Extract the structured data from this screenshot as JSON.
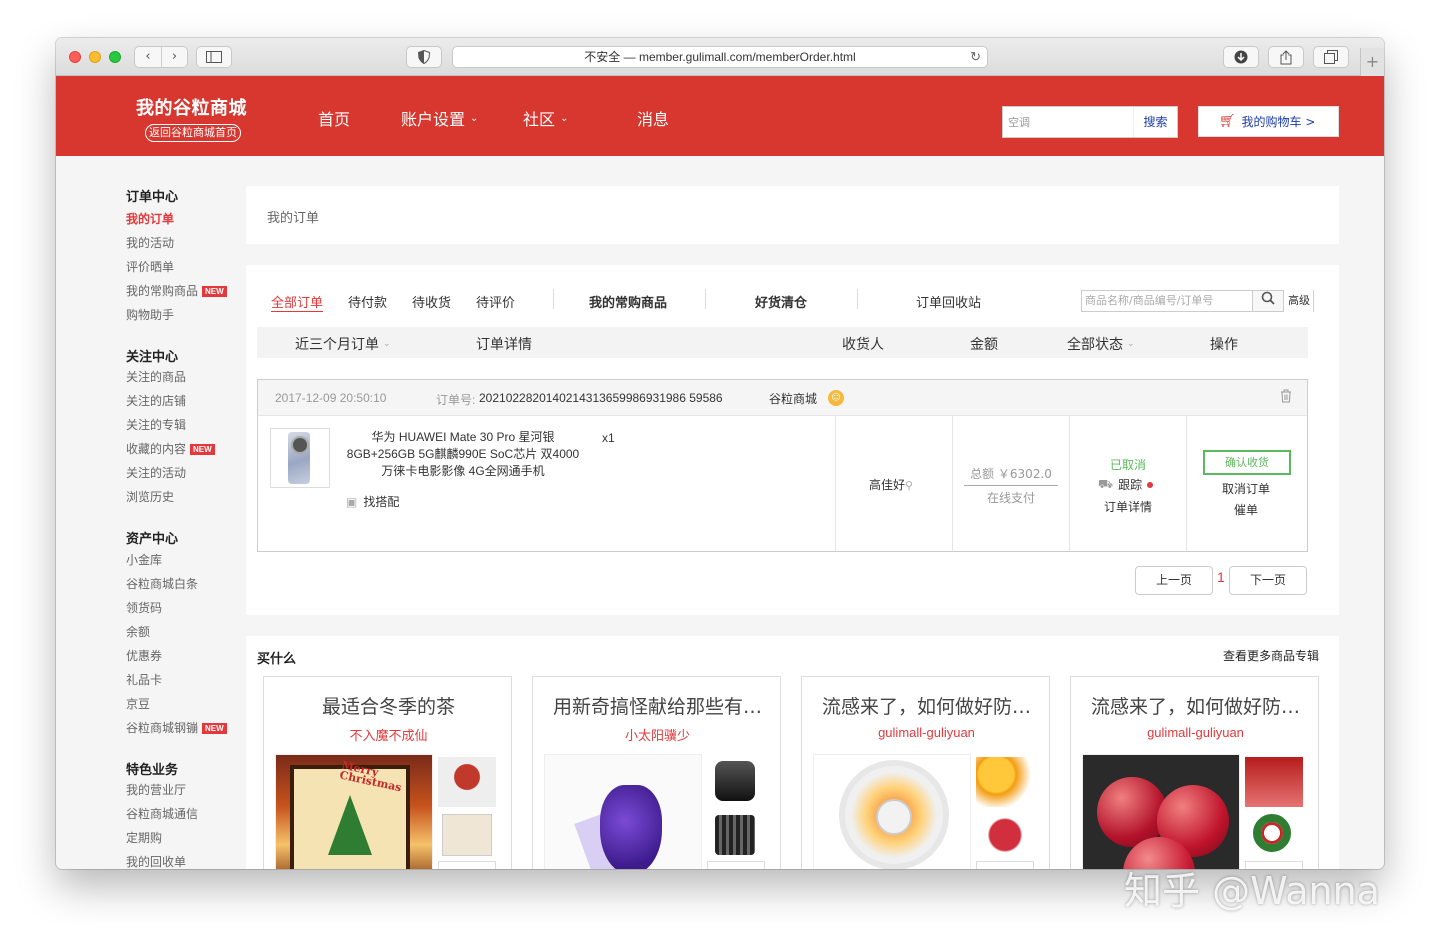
{
  "browser": {
    "nav_back": "‹",
    "nav_forward": "›",
    "address": "不安全 — member.gulimall.com/memberOrder.html",
    "reload_icon": "↻",
    "new_tab": "+"
  },
  "header": {
    "logo": "我的谷粒商城",
    "back_home": "返回谷粒商城首页",
    "nav": [
      {
        "label": "首页",
        "has_caret": false
      },
      {
        "label": "账户设置",
        "has_caret": true
      },
      {
        "label": "社区",
        "has_caret": true
      },
      {
        "label": "消息",
        "has_caret": false
      }
    ],
    "caret": "⌄",
    "search_value": "空调",
    "search_button": "搜索",
    "cart_label": "我的购物车 >"
  },
  "sidebar": {
    "sections": [
      {
        "title": "订单中心",
        "items": [
          {
            "label": "我的订单",
            "active": true
          },
          {
            "label": "我的活动"
          },
          {
            "label": "评价晒单"
          },
          {
            "label": "我的常购商品",
            "badge": "NEW"
          },
          {
            "label": "购物助手"
          }
        ]
      },
      {
        "title": "关注中心",
        "items": [
          {
            "label": "关注的商品"
          },
          {
            "label": "关注的店铺"
          },
          {
            "label": "关注的专辑"
          },
          {
            "label": "收藏的内容",
            "badge": "NEW"
          },
          {
            "label": "关注的活动"
          },
          {
            "label": "浏览历史"
          }
        ]
      },
      {
        "title": "资产中心",
        "items": [
          {
            "label": "小金库"
          },
          {
            "label": "谷粒商城白条"
          },
          {
            "label": "领货码"
          },
          {
            "label": "余额"
          },
          {
            "label": "优惠券"
          },
          {
            "label": "礼品卡"
          },
          {
            "label": "京豆"
          },
          {
            "label": "谷粒商城钢镚",
            "badge": "NEW"
          }
        ]
      },
      {
        "title": "特色业务",
        "items": [
          {
            "label": "我的营业厅"
          },
          {
            "label": "谷粒商城通信"
          },
          {
            "label": "定期购"
          },
          {
            "label": "我的回收单"
          }
        ]
      }
    ]
  },
  "main": {
    "page_title": "我的订单",
    "tabs": [
      "全部订单",
      "待付款",
      "待收货",
      "待评价",
      "我的常购商品",
      "好货清仓",
      "订单回收站"
    ],
    "order_search_placeholder": "商品名称/商品编号/订单号",
    "advanced": "高级",
    "columns": {
      "range": "近三个月订单",
      "detail": "订单详情",
      "recipient": "收货人",
      "amount": "金额",
      "status": "全部状态",
      "action": "操作"
    },
    "order": {
      "time": "2017-12-09 20:50:10",
      "order_no_label": "订单号:",
      "order_no": "2021022820140214313659986931986 59586",
      "shop": "谷粒商城",
      "product_lines": [
        "华为 HUAWEI Mate 30 Pro 星河银",
        "8GB+256GB 5G麒麟990E SoC芯片 双4000",
        "万徕卡电影影像 4G全网通手机"
      ],
      "qty": "x1",
      "bundle": "找搭配",
      "recipient": "高佳好",
      "amount": "总额 ￥6302.0",
      "pay_method": "在线支付",
      "status": "已取消",
      "track": "跟踪",
      "detail": "订单详情",
      "confirm": "确认收货",
      "cancel": "取消订单",
      "urge": "催单"
    },
    "pagination": {
      "prev": "上一页",
      "current": "1",
      "next": "下一页"
    }
  },
  "buy": {
    "title": "买什么",
    "more": "查看更多商品专辑",
    "cards": [
      {
        "title": "最适合冬季的茶",
        "sub": "不入魔不成仙"
      },
      {
        "title": "用新奇搞怪献给那些有…",
        "sub": "小太阳骥少"
      },
      {
        "title": "流感来了，如何做好防…",
        "sub": "gulimall-guliyuan"
      },
      {
        "title": "流感来了，如何做好防…",
        "sub": "gulimall-guliyuan"
      }
    ]
  },
  "watermark": "知乎 @Wanna"
}
